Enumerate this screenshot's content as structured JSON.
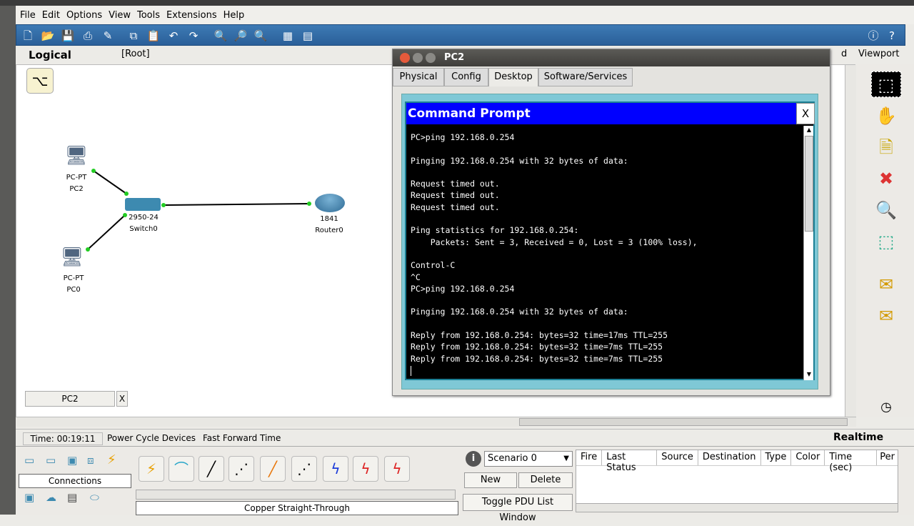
{
  "menu": [
    "File",
    "Edit",
    "Options",
    "View",
    "Tools",
    "Extensions",
    "Help"
  ],
  "logical": {
    "label": "Logical",
    "root": "[Root]",
    "viewport": "Viewport",
    "cluster": "d"
  },
  "devices": {
    "pc2": {
      "type": "PC-PT",
      "name": "PC2"
    },
    "switch": {
      "type": "2950-24",
      "name": "Switch0"
    },
    "router": {
      "type": "1841",
      "name": "Router0"
    },
    "pc0": {
      "type": "PC-PT",
      "name": "PC0"
    }
  },
  "pc2_window": {
    "title": "PC2",
    "tabs": [
      "Physical",
      "Config",
      "Desktop",
      "Software/Services"
    ],
    "active_tab": "Desktop"
  },
  "command_prompt": {
    "title": "Command Prompt",
    "close": "X",
    "lines": [
      "PC>ping 192.168.0.254",
      "",
      "Pinging 192.168.0.254 with 32 bytes of data:",
      "",
      "Request timed out.",
      "Request timed out.",
      "Request timed out.",
      "",
      "Ping statistics for 192.168.0.254:",
      "    Packets: Sent = 3, Received = 0, Lost = 3 (100% loss),",
      "",
      "Control-C",
      "^C",
      "PC>ping 192.168.0.254",
      "",
      "Pinging 192.168.0.254 with 32 bytes of data:",
      "",
      "Reply from 192.168.0.254: bytes=32 time=17ms TTL=255",
      "Reply from 192.168.0.254: bytes=32 time=7ms TTL=255",
      "Reply from 192.168.0.254: bytes=32 time=7ms TTL=255"
    ]
  },
  "tab_chip": {
    "label": "PC2",
    "close": "X"
  },
  "status": {
    "time": "Time: 00:19:11",
    "power": "Power Cycle Devices",
    "fast": "Fast Forward Time",
    "mode": "Realtime"
  },
  "bottom": {
    "connections": "Connections",
    "selected_cable": "Copper Straight-Through",
    "scenario": "Scenario 0",
    "new": "New",
    "delete": "Delete",
    "toggle": "Toggle PDU List Window",
    "pdu_columns": [
      "Fire",
      "Last Status",
      "Source",
      "Destination",
      "Type",
      "Color",
      "Time (sec)",
      "Per"
    ]
  }
}
